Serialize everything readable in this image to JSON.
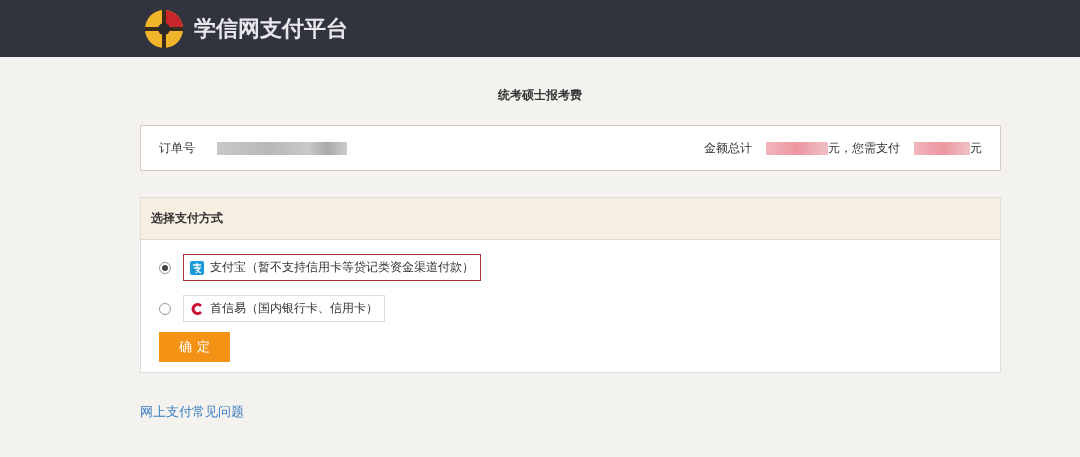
{
  "header": {
    "title": "学信网支付平台"
  },
  "page_title": "统考硕士报考费",
  "order": {
    "order_label": "订单号",
    "total_label": "金额总计",
    "pay_label": "元，您需支付",
    "pay_unit": "元"
  },
  "payment": {
    "title": "选择支付方式",
    "methods": [
      {
        "kind": "alipay",
        "label": "支付宝（暂不支持信用卡等贷记类资金渠道付款）",
        "selected": true
      },
      {
        "kind": "payease",
        "label": "首信易（国内银行卡、信用卡）",
        "selected": false
      }
    ],
    "confirm": "确 定"
  },
  "faq_link": "网上支付常见问题"
}
